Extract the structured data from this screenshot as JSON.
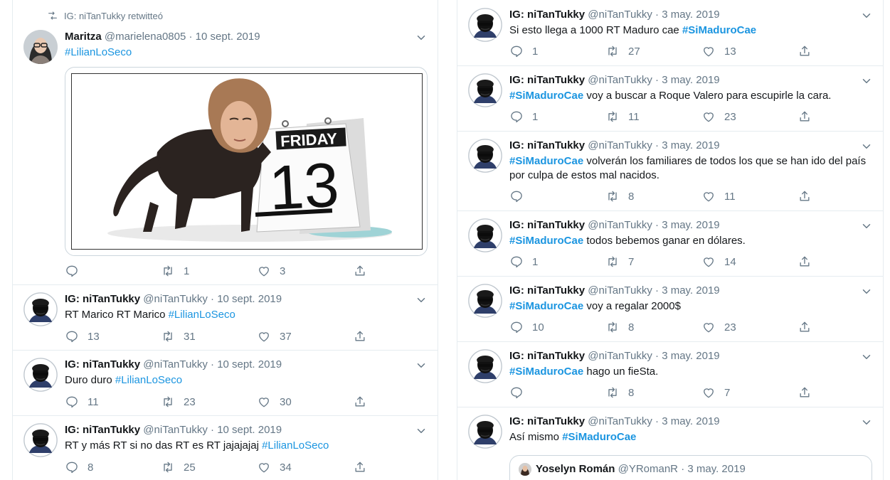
{
  "colors": {
    "link": "#1b95e0",
    "muted": "#657786",
    "text": "#14171a",
    "border": "#e6ecf0"
  },
  "icons": {
    "reply": "speech-bubble-icon",
    "retweet": "retweet-icon",
    "like": "heart-icon",
    "share": "share-icon",
    "caret": "chevron-down-icon"
  },
  "left": {
    "tweets": [
      {
        "retweeted_by": "IG: niTanTukky retwitteó",
        "name": "Maritza",
        "handle": "@marielena0805",
        "sep": "·",
        "date": "10 sept. 2019",
        "hashtag": "#LilianLoSeco",
        "media_text": {
          "day": "FRIDAY",
          "number": "13"
        },
        "replies": "",
        "retweets": "1",
        "likes": "3"
      },
      {
        "name": "IG: niTanTukky",
        "handle": "@niTanTukky",
        "sep": "·",
        "date": "10 sept. 2019",
        "text": "RT Marico RT Marico ",
        "hashtag": "#LilianLoSeco",
        "replies": "13",
        "retweets": "31",
        "likes": "37"
      },
      {
        "name": "IG: niTanTukky",
        "handle": "@niTanTukky",
        "sep": "·",
        "date": "10 sept. 2019",
        "text": "Duro duro ",
        "hashtag": "#LilianLoSeco",
        "replies": "11",
        "retweets": "23",
        "likes": "30"
      },
      {
        "name": "IG: niTanTukky",
        "handle": "@niTanTukky",
        "sep": "·",
        "date": "10 sept. 2019",
        "text": "RT y más RT si no das RT es RT jajajajaj ",
        "hashtag": "#LilianLoSeco",
        "replies": "8",
        "retweets": "25",
        "likes": "34"
      }
    ]
  },
  "right": {
    "tweets": [
      {
        "name": "IG: niTanTukky",
        "handle": "@niTanTukky",
        "sep": "·",
        "date": "3 may. 2019",
        "pre": "Si esto llega a 1000 RT Maduro cae ",
        "hashtag": "#SiMaduroCae",
        "post": "",
        "replies": "1",
        "retweets": "27",
        "likes": "13"
      },
      {
        "name": "IG: niTanTukky",
        "handle": "@niTanTukky",
        "sep": "·",
        "date": "3 may. 2019",
        "pre": "",
        "hashtag": "#SiMaduroCae",
        "post": " voy a buscar a Roque Valero para escupirle la cara.",
        "replies": "1",
        "retweets": "11",
        "likes": "23"
      },
      {
        "name": "IG: niTanTukky",
        "handle": "@niTanTukky",
        "sep": "·",
        "date": "3 may. 2019",
        "pre": "",
        "hashtag": "#SiMaduroCae",
        "post": " volverán los familiares de todos los que se han ido del país por culpa de estos mal nacidos.",
        "replies": "",
        "retweets": "8",
        "likes": "11"
      },
      {
        "name": "IG: niTanTukky",
        "handle": "@niTanTukky",
        "sep": "·",
        "date": "3 may. 2019",
        "pre": "",
        "hashtag": "#SiMaduroCae",
        "post": " todos bebemos ganar en dólares.",
        "replies": "1",
        "retweets": "7",
        "likes": "14"
      },
      {
        "name": "IG: niTanTukky",
        "handle": "@niTanTukky",
        "sep": "·",
        "date": "3 may. 2019",
        "pre": "",
        "hashtag": "#SiMaduroCae",
        "post": " voy a regalar 2000$",
        "replies": "10",
        "retweets": "8",
        "likes": "23"
      },
      {
        "name": "IG: niTanTukky",
        "handle": "@niTanTukky",
        "sep": "·",
        "date": "3 may. 2019",
        "pre": "",
        "hashtag": "#SiMaduroCae",
        "post": " hago un fieSta.",
        "replies": "",
        "retweets": "8",
        "likes": "7"
      },
      {
        "name": "IG: niTanTukky",
        "handle": "@niTanTukky",
        "sep": "·",
        "date": "3 may. 2019",
        "pre": "Así mismo ",
        "hashtag": "#SiMaduroCae",
        "post": "",
        "quote": {
          "name": "Yoselyn Román",
          "handle": "@YRomanR",
          "sep": "·",
          "date": "3 may. 2019"
        }
      }
    ]
  }
}
